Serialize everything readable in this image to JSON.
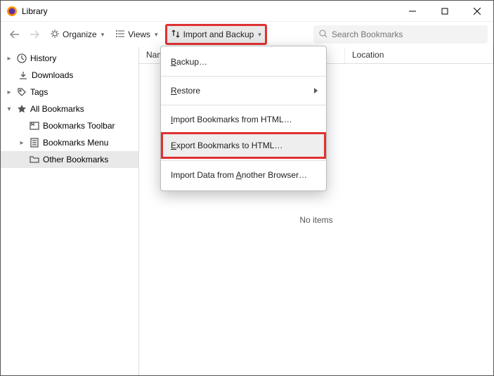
{
  "window": {
    "title": "Library"
  },
  "toolbar": {
    "organize": "Organize",
    "views": "Views",
    "import_backup": "Import and Backup",
    "search_placeholder": "Search Bookmarks"
  },
  "sidebar": {
    "items": [
      {
        "label": "History"
      },
      {
        "label": "Downloads"
      },
      {
        "label": "Tags"
      },
      {
        "label": "All Bookmarks"
      },
      {
        "label": "Bookmarks Toolbar"
      },
      {
        "label": "Bookmarks Menu"
      },
      {
        "label": "Other Bookmarks"
      }
    ]
  },
  "columns": {
    "name": "Name",
    "location": "Location"
  },
  "content": {
    "empty": "No items"
  },
  "menu": {
    "backup": {
      "pre": "",
      "u": "B",
      "post": "ackup…"
    },
    "restore": {
      "pre": "",
      "u": "R",
      "post": "estore"
    },
    "import_html": {
      "pre": "",
      "u": "I",
      "post": "mport Bookmarks from HTML…"
    },
    "export_html": {
      "pre": "",
      "u": "E",
      "post": "xport Bookmarks to HTML…"
    },
    "import_browser": {
      "pre": "Import Data from ",
      "u": "A",
      "post": "nother Browser…"
    }
  }
}
